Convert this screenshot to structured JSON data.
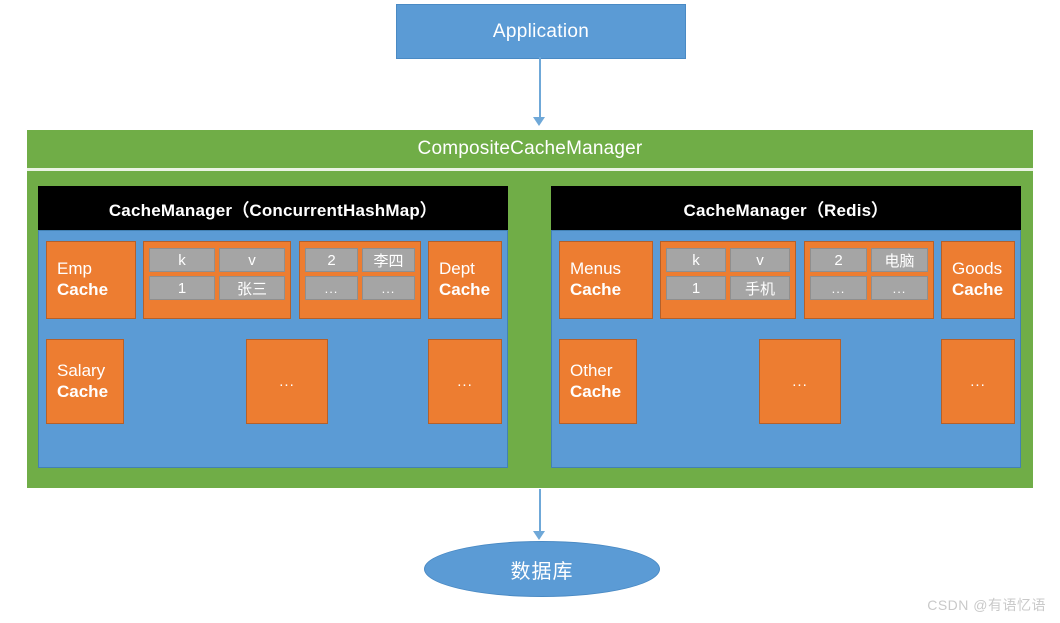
{
  "application": {
    "label": "Application"
  },
  "composite": {
    "title": "CompositeCacheManager"
  },
  "managers": [
    {
      "header": "CacheManager（ConcurrentHashMap）",
      "primary_cache": {
        "name": "Emp",
        "kind": "Cache"
      },
      "table_left": {
        "header": [
          "k",
          "v"
        ],
        "rows": [
          [
            "1",
            "张三"
          ]
        ]
      },
      "table_right": {
        "header": [
          "2",
          "李四"
        ],
        "rows": [
          [
            "...",
            "..."
          ]
        ]
      },
      "side_cache": {
        "name": "Dept",
        "kind": "Cache"
      },
      "row2_cache": {
        "name": "Salary",
        "kind": "Cache"
      },
      "row2_middle_ellipsis": "...",
      "row2_right_ellipsis": "..."
    },
    {
      "header": "CacheManager（Redis）",
      "primary_cache": {
        "name": "Menus",
        "kind": "Cache"
      },
      "table_left": {
        "header": [
          "k",
          "v"
        ],
        "rows": [
          [
            "1",
            "手机"
          ]
        ]
      },
      "table_right": {
        "header": [
          "2",
          "电脑"
        ],
        "rows": [
          [
            "...",
            "..."
          ]
        ]
      },
      "side_cache": {
        "name": "Goods",
        "kind": "Cache"
      },
      "row2_cache": {
        "name": "Other",
        "kind": "Cache"
      },
      "row2_middle_ellipsis": "...",
      "row2_right_ellipsis": "..."
    }
  ],
  "database": {
    "label": "数据库"
  },
  "watermark": {
    "text": "CSDN @有语忆语"
  },
  "colors": {
    "application_blue": "#5b9bd5",
    "composite_green": "#70ad47",
    "manager_header_black": "#000000",
    "manager_body_blue": "#5b9bd5",
    "cache_orange": "#ed7d31",
    "table_cell_gray": "#a5a5a5",
    "arrow_blue": "#6fa8d8",
    "watermark_gray": "#c9c9c9"
  }
}
